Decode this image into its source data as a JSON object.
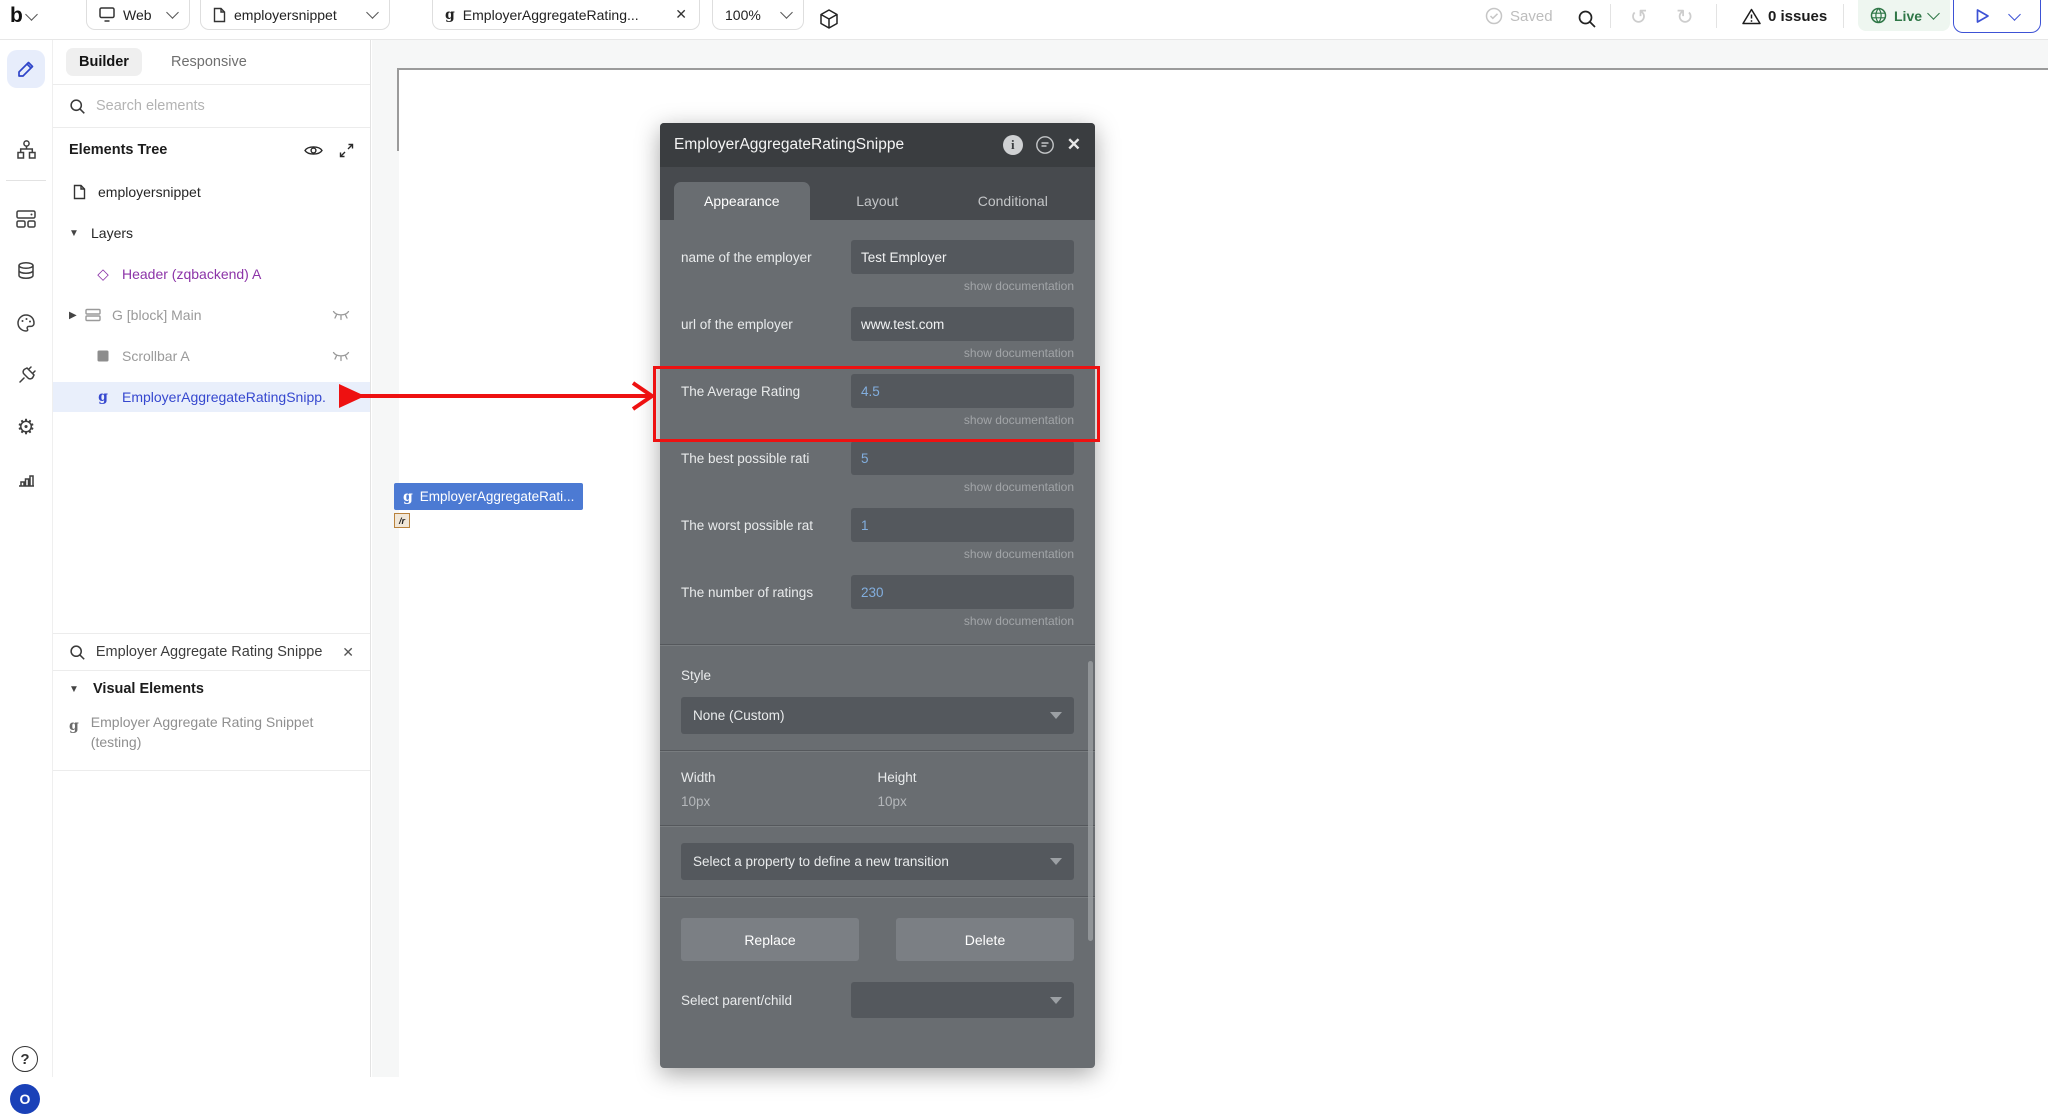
{
  "topbar": {
    "logo_text": "b",
    "env_label": "Web",
    "page_tab": "employersnippet",
    "element_tab": "EmployerAggregateRating...",
    "zoom_level": "100%",
    "saved_label": "Saved",
    "issues_label": "0 issues",
    "live_label": "Live"
  },
  "left_panel": {
    "tab_builder": "Builder",
    "tab_responsive": "Responsive",
    "search_placeholder": "Search elements",
    "tree_title": "Elements Tree",
    "root_item": "employersnippet",
    "layers_label": "Layers",
    "tree_items": [
      {
        "label": "Header (zqbackend) A"
      },
      {
        "label": "G [block] Main"
      },
      {
        "label": "Scrollbar A"
      },
      {
        "label": "EmployerAggregateRatingSnipp."
      }
    ],
    "search2_value": "Employer Aggregate Rating Snippe",
    "visual_elements_title": "Visual Elements",
    "result_item": "Employer Aggregate Rating Snippet (testing)",
    "g_glyph": "g"
  },
  "canvas": {
    "element_chip": "EmployerAggregateRati...",
    "tiny_element": "/r",
    "g_glyph": "g"
  },
  "inspector": {
    "title": "EmployerAggregateRatingSnippe",
    "tabs": [
      {
        "label": "Appearance"
      },
      {
        "label": "Layout"
      },
      {
        "label": "Conditional"
      }
    ],
    "info_glyph": "i",
    "close_glyph": "✕",
    "show_doc": "show documentation",
    "fields": [
      {
        "label": "name of the employer",
        "value": "Test Employer"
      },
      {
        "label": "url of the employer",
        "value": "www.test.com"
      },
      {
        "label": "The Average Rating",
        "value": "4.5"
      },
      {
        "label": "The best possible rati",
        "value": "5"
      },
      {
        "label": "The worst possible rat",
        "value": "1"
      },
      {
        "label": "The number of ratings",
        "value": "230"
      }
    ],
    "style_label": "Style",
    "style_value": "None (Custom)",
    "width_label": "Width",
    "width_value": "10px",
    "height_label": "Height",
    "height_value": "10px",
    "transition_placeholder": "Select a property to define a new transition",
    "replace_label": "Replace",
    "delete_label": "Delete",
    "parent_child_label": "Select parent/child"
  },
  "help_glyph": "?",
  "avatar_glyph": "O",
  "colors": {
    "annotation_red": "#ee1111",
    "accent_blue": "#3d52d5",
    "live_green": "#2f7747",
    "dynamic_value_blue": "#82aede",
    "chip_blue": "#4c7ad3",
    "selected_row_blue": "#e9effb"
  }
}
